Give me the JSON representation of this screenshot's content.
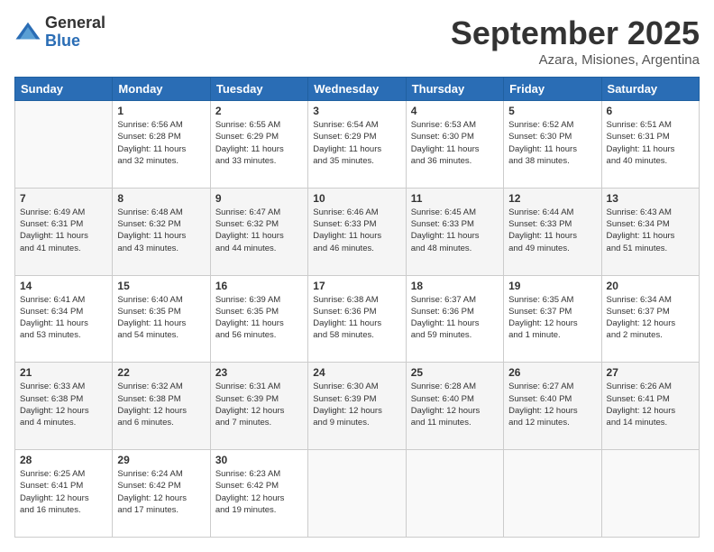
{
  "logo": {
    "general": "General",
    "blue": "Blue"
  },
  "title": "September 2025",
  "subtitle": "Azara, Misiones, Argentina",
  "days_of_week": [
    "Sunday",
    "Monday",
    "Tuesday",
    "Wednesday",
    "Thursday",
    "Friday",
    "Saturday"
  ],
  "weeks": [
    [
      {
        "day": "",
        "info": ""
      },
      {
        "day": "1",
        "info": "Sunrise: 6:56 AM\nSunset: 6:28 PM\nDaylight: 11 hours\nand 32 minutes."
      },
      {
        "day": "2",
        "info": "Sunrise: 6:55 AM\nSunset: 6:29 PM\nDaylight: 11 hours\nand 33 minutes."
      },
      {
        "day": "3",
        "info": "Sunrise: 6:54 AM\nSunset: 6:29 PM\nDaylight: 11 hours\nand 35 minutes."
      },
      {
        "day": "4",
        "info": "Sunrise: 6:53 AM\nSunset: 6:30 PM\nDaylight: 11 hours\nand 36 minutes."
      },
      {
        "day": "5",
        "info": "Sunrise: 6:52 AM\nSunset: 6:30 PM\nDaylight: 11 hours\nand 38 minutes."
      },
      {
        "day": "6",
        "info": "Sunrise: 6:51 AM\nSunset: 6:31 PM\nDaylight: 11 hours\nand 40 minutes."
      }
    ],
    [
      {
        "day": "7",
        "info": "Sunrise: 6:49 AM\nSunset: 6:31 PM\nDaylight: 11 hours\nand 41 minutes."
      },
      {
        "day": "8",
        "info": "Sunrise: 6:48 AM\nSunset: 6:32 PM\nDaylight: 11 hours\nand 43 minutes."
      },
      {
        "day": "9",
        "info": "Sunrise: 6:47 AM\nSunset: 6:32 PM\nDaylight: 11 hours\nand 44 minutes."
      },
      {
        "day": "10",
        "info": "Sunrise: 6:46 AM\nSunset: 6:33 PM\nDaylight: 11 hours\nand 46 minutes."
      },
      {
        "day": "11",
        "info": "Sunrise: 6:45 AM\nSunset: 6:33 PM\nDaylight: 11 hours\nand 48 minutes."
      },
      {
        "day": "12",
        "info": "Sunrise: 6:44 AM\nSunset: 6:33 PM\nDaylight: 11 hours\nand 49 minutes."
      },
      {
        "day": "13",
        "info": "Sunrise: 6:43 AM\nSunset: 6:34 PM\nDaylight: 11 hours\nand 51 minutes."
      }
    ],
    [
      {
        "day": "14",
        "info": "Sunrise: 6:41 AM\nSunset: 6:34 PM\nDaylight: 11 hours\nand 53 minutes."
      },
      {
        "day": "15",
        "info": "Sunrise: 6:40 AM\nSunset: 6:35 PM\nDaylight: 11 hours\nand 54 minutes."
      },
      {
        "day": "16",
        "info": "Sunrise: 6:39 AM\nSunset: 6:35 PM\nDaylight: 11 hours\nand 56 minutes."
      },
      {
        "day": "17",
        "info": "Sunrise: 6:38 AM\nSunset: 6:36 PM\nDaylight: 11 hours\nand 58 minutes."
      },
      {
        "day": "18",
        "info": "Sunrise: 6:37 AM\nSunset: 6:36 PM\nDaylight: 11 hours\nand 59 minutes."
      },
      {
        "day": "19",
        "info": "Sunrise: 6:35 AM\nSunset: 6:37 PM\nDaylight: 12 hours\nand 1 minute."
      },
      {
        "day": "20",
        "info": "Sunrise: 6:34 AM\nSunset: 6:37 PM\nDaylight: 12 hours\nand 2 minutes."
      }
    ],
    [
      {
        "day": "21",
        "info": "Sunrise: 6:33 AM\nSunset: 6:38 PM\nDaylight: 12 hours\nand 4 minutes."
      },
      {
        "day": "22",
        "info": "Sunrise: 6:32 AM\nSunset: 6:38 PM\nDaylight: 12 hours\nand 6 minutes."
      },
      {
        "day": "23",
        "info": "Sunrise: 6:31 AM\nSunset: 6:39 PM\nDaylight: 12 hours\nand 7 minutes."
      },
      {
        "day": "24",
        "info": "Sunrise: 6:30 AM\nSunset: 6:39 PM\nDaylight: 12 hours\nand 9 minutes."
      },
      {
        "day": "25",
        "info": "Sunrise: 6:28 AM\nSunset: 6:40 PM\nDaylight: 12 hours\nand 11 minutes."
      },
      {
        "day": "26",
        "info": "Sunrise: 6:27 AM\nSunset: 6:40 PM\nDaylight: 12 hours\nand 12 minutes."
      },
      {
        "day": "27",
        "info": "Sunrise: 6:26 AM\nSunset: 6:41 PM\nDaylight: 12 hours\nand 14 minutes."
      }
    ],
    [
      {
        "day": "28",
        "info": "Sunrise: 6:25 AM\nSunset: 6:41 PM\nDaylight: 12 hours\nand 16 minutes."
      },
      {
        "day": "29",
        "info": "Sunrise: 6:24 AM\nSunset: 6:42 PM\nDaylight: 12 hours\nand 17 minutes."
      },
      {
        "day": "30",
        "info": "Sunrise: 6:23 AM\nSunset: 6:42 PM\nDaylight: 12 hours\nand 19 minutes."
      },
      {
        "day": "",
        "info": ""
      },
      {
        "day": "",
        "info": ""
      },
      {
        "day": "",
        "info": ""
      },
      {
        "day": "",
        "info": ""
      }
    ]
  ]
}
